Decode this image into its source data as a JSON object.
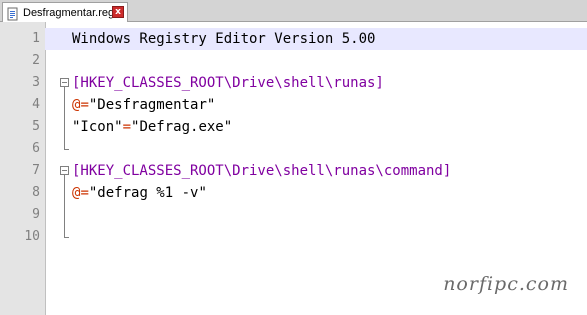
{
  "tab": {
    "filename": "Desfragmentar.reg",
    "close_label": "x",
    "icon": "document-icon"
  },
  "editor": {
    "lines": [
      {
        "num": "1",
        "parts": [
          {
            "text": "Windows Registry Editor Version 5.00",
            "kind": "plain"
          }
        ]
      },
      {
        "num": "2",
        "parts": []
      },
      {
        "num": "3",
        "parts": [
          {
            "text": "[HKEY_CLASSES_ROOT\\Drive\\shell\\runas]",
            "kind": "key"
          }
        ]
      },
      {
        "num": "4",
        "parts": [
          {
            "text": "@",
            "kind": "op"
          },
          {
            "text": "=",
            "kind": "op"
          },
          {
            "text": "\"Desfragmentar\"",
            "kind": "str"
          }
        ]
      },
      {
        "num": "5",
        "parts": [
          {
            "text": "\"Icon\"",
            "kind": "str"
          },
          {
            "text": "=",
            "kind": "op"
          },
          {
            "text": "\"Defrag.exe\"",
            "kind": "str"
          }
        ]
      },
      {
        "num": "6",
        "parts": []
      },
      {
        "num": "7",
        "parts": [
          {
            "text": "[HKEY_CLASSES_ROOT\\Drive\\shell\\runas\\command]",
            "kind": "key"
          }
        ]
      },
      {
        "num": "8",
        "parts": [
          {
            "text": "@",
            "kind": "op"
          },
          {
            "text": "=",
            "kind": "op"
          },
          {
            "text": "\"defrag %1 -v\"",
            "kind": "str"
          }
        ]
      },
      {
        "num": "9",
        "parts": []
      },
      {
        "num": "10",
        "parts": []
      }
    ],
    "current_line": 1,
    "fold_lines": [
      3,
      7
    ]
  },
  "watermark": "norfipc.com",
  "colors": {
    "key": "#8000a0",
    "operator": "#cc3300",
    "string": "#000000",
    "current_line_bg": "#e8e8ff",
    "gutter_bg": "#e4e4e4"
  }
}
